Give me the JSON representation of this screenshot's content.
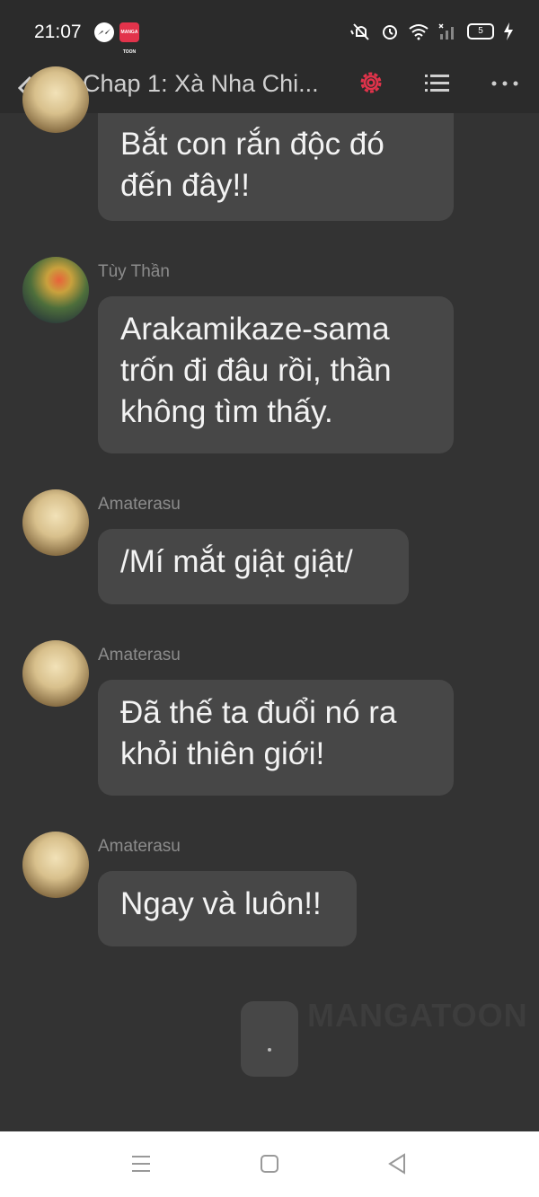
{
  "status_bar": {
    "time": "21:07",
    "app_badge": "MANGA TOON",
    "battery": "5"
  },
  "header": {
    "title": "Chap 1: Xà Nha Chi...",
    "icons": [
      "back-icon",
      "settings-icon",
      "list-icon",
      "more-icon"
    ],
    "accent_color": "#e2334b"
  },
  "messages": [
    {
      "sender": "",
      "text_lines": [
        "Bắt con rắn độc đó",
        "đến đây!!"
      ]
    },
    {
      "sender": "Tùy Thần",
      "text_lines": [
        "Arakamikaze-sama",
        "trốn đi đâu rồi, thần",
        "không tìm thấy."
      ]
    },
    {
      "sender": "Amaterasu",
      "text_lines": [
        "/Mí mắt giật giật/"
      ]
    },
    {
      "sender": "Amaterasu",
      "text_lines": [
        "Đã thế ta đuổi nó ra",
        "khỏi thiên giới!"
      ]
    },
    {
      "sender": "Amaterasu",
      "text_lines": [
        "Ngay và luôn!!"
      ]
    }
  ],
  "watermark": "MANGATOON",
  "nav_bar": {
    "icons": [
      "menu-icon",
      "home-icon",
      "back-triangle-icon"
    ]
  }
}
